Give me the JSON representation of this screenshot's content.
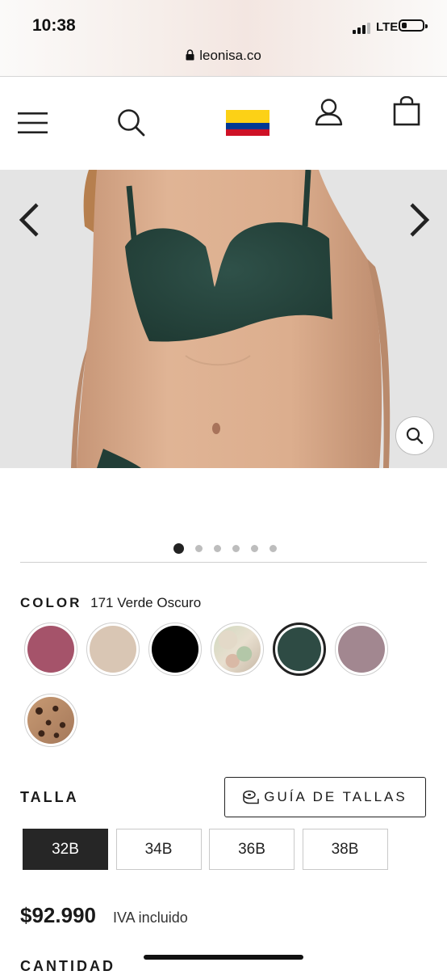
{
  "status_bar": {
    "time": "10:38",
    "network": "LTE",
    "signal_bars": 3,
    "battery_level": 0.25
  },
  "browser": {
    "url": "leonisa.co",
    "lock_icon": "lock-icon"
  },
  "header": {
    "icons": [
      "menu-icon",
      "search-icon",
      "colombia-flag-icon",
      "account-icon",
      "bag-icon"
    ],
    "flag_colors": [
      "#fcd116",
      "#003893",
      "#ce1126"
    ]
  },
  "gallery": {
    "image_count": 6,
    "current_index": 0
  },
  "color": {
    "label": "COLOR",
    "selected_name": "171 Verde Oscuro",
    "swatches": [
      {
        "name": "rose",
        "color": "#a5536a"
      },
      {
        "name": "nude",
        "color": "#d9c6b4"
      },
      {
        "name": "black",
        "color": "#000000"
      },
      {
        "name": "print",
        "color": "#cfc8b0"
      },
      {
        "name": "verde-oscuro",
        "color": "#2e4b44",
        "selected": true
      },
      {
        "name": "mauve",
        "color": "#a28790"
      },
      {
        "name": "leopard",
        "color": "#a5785a"
      }
    ]
  },
  "talla": {
    "label": "TALLA",
    "guide_label": "GUÍA DE TALLAS",
    "sizes": [
      "32B",
      "34B",
      "36B",
      "38B"
    ],
    "selected": "32B"
  },
  "price": {
    "amount": "$92.990",
    "tax_note": "IVA incluido"
  },
  "cantidad_label": "CANTIDAD"
}
